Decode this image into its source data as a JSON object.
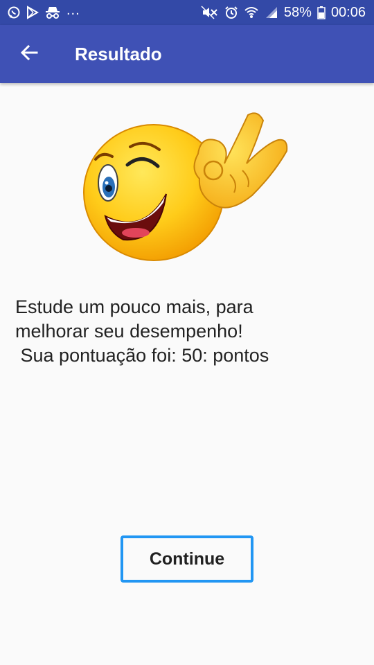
{
  "status_bar": {
    "left_icons": [
      "whatsapp-icon",
      "play-store-icon",
      "incognito-icon"
    ],
    "more": "...",
    "right_icons": [
      "mute-icon",
      "alarm-icon",
      "wifi-icon",
      "signal-icon",
      "battery-icon"
    ],
    "battery": "58%",
    "time": "00:06"
  },
  "app_bar": {
    "back_icon": "arrow-left-icon",
    "title": "Resultado",
    "color": "#3f51b5"
  },
  "main": {
    "image_icon": "winking-ok-emoji",
    "message": "Estude um pouco mais, para\nmelhorar seu desempenho!\n Sua pontuação foi: 50: pontos",
    "continue_label": "Continue",
    "accent": "#2196f3"
  }
}
